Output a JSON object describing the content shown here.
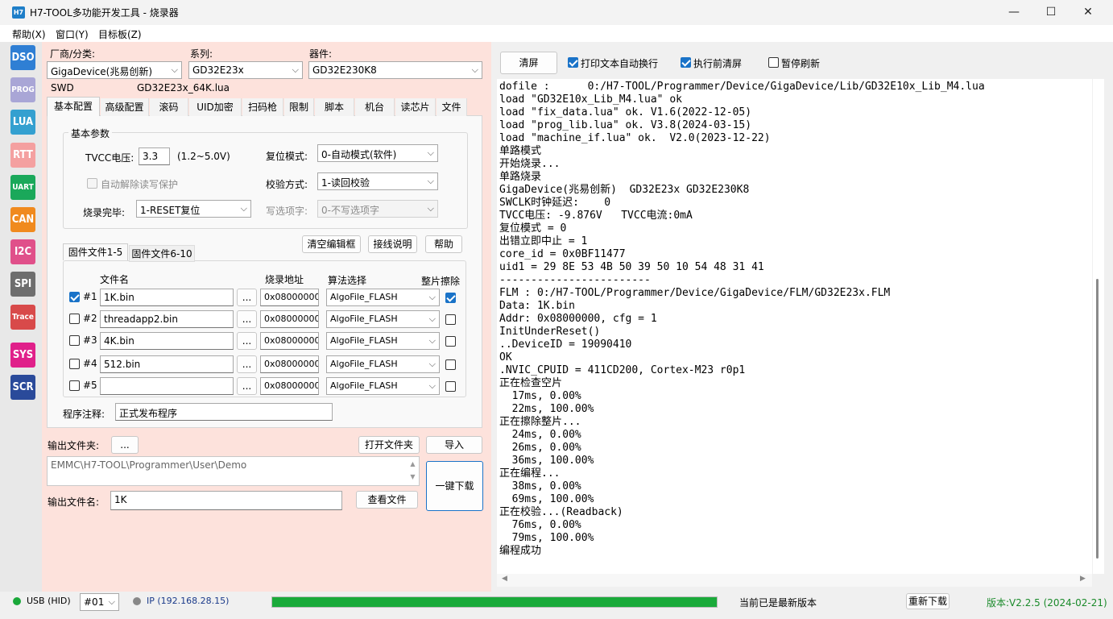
{
  "window": {
    "title": "H7-TOOL多功能开发工具 - 烧录器",
    "icon_text": "H7",
    "minimize": "—",
    "maximize": "☐",
    "close": "✕"
  },
  "menu": [
    "帮助(X)",
    "窗口(Y)",
    "目标板(Z)"
  ],
  "sidebar": [
    {
      "label": "DSO",
      "color": "#2f7fd4"
    },
    {
      "label": "PROG",
      "color": "#a9a6d6"
    },
    {
      "label": "LUA",
      "color": "#34a0d0"
    },
    {
      "label": "RTT",
      "color": "#f4a0a0"
    },
    {
      "label": "UART",
      "color": "#1aa85a"
    },
    {
      "label": "CAN",
      "color": "#f08a1e"
    },
    {
      "label": "I2C",
      "color": "#e0508a"
    },
    {
      "label": "SPI",
      "color": "#6e6e6e"
    },
    {
      "label": "Trace",
      "color": "#d84a4a"
    },
    {
      "label": "SYS",
      "color": "#e0208a"
    },
    {
      "label": "SCR",
      "color": "#2a4a9a"
    }
  ],
  "device": {
    "vendor_label": "厂商/分类:",
    "vendor_value": "GigaDevice(兆易创新)",
    "series_label": "系列:",
    "series_value": "GD32E23x",
    "chip_label": "器件:",
    "chip_value": "GD32E230K8",
    "interface": "SWD",
    "lua_file": "GD32E23x_64K.lua"
  },
  "tabs": [
    "基本配置",
    "高级配置",
    "滚码",
    "UID加密",
    "扫码枪",
    "限制",
    "脚本",
    "机台",
    "读芯片",
    "文件"
  ],
  "basic": {
    "group_title": "基本参数",
    "tvcc_label": "TVCC电压:",
    "tvcc_value": "3.3",
    "tvcc_range": "(1.2~5.0V)",
    "auto_unlock_label": "自动解除读写保护",
    "after_prog_label": "烧录完毕:",
    "after_prog_value": "1-RESET复位",
    "reset_mode_label": "复位模式:",
    "reset_mode_value": "0-自动模式(软件)",
    "verify_label": "校验方式:",
    "verify_value": "1-读回校验",
    "option_label": "写选项字:",
    "option_value": "0-不写选项字"
  },
  "buttons": {
    "clear_prog": "清空编辑框",
    "wiring": "接线说明",
    "help": "帮助"
  },
  "filetabs": [
    "固件文件1-5",
    "固件文件6-10"
  ],
  "file_headers": {
    "name": "文件名",
    "addr": "烧录地址",
    "algo": "算法选择",
    "erase": "整片擦除"
  },
  "files": [
    {
      "num": "#1",
      "checked": true,
      "name": "1K.bin",
      "browse": "...",
      "addr": "0x08000000",
      "algo": "AlgoFile_FLASH",
      "erase": true
    },
    {
      "num": "#2",
      "checked": false,
      "name": "threadapp2.bin",
      "browse": "...",
      "addr": "0x08000000",
      "algo": "AlgoFile_FLASH",
      "erase": false
    },
    {
      "num": "#3",
      "checked": false,
      "name": "4K.bin",
      "browse": "...",
      "addr": "0x08000000",
      "algo": "AlgoFile_FLASH",
      "erase": false
    },
    {
      "num": "#4",
      "checked": false,
      "name": "512.bin",
      "browse": "...",
      "addr": "0x08000000",
      "algo": "AlgoFile_FLASH",
      "erase": false
    },
    {
      "num": "#5",
      "checked": false,
      "name": "",
      "browse": "...",
      "addr": "0x08000000",
      "algo": "AlgoFile_FLASH",
      "erase": false
    }
  ],
  "comment": {
    "label": "程序注释:",
    "value": "正式发布程序"
  },
  "output": {
    "folder_label": "输出文件夹:",
    "folder_btn": "...",
    "open_folder": "打开文件夹",
    "import": "导入",
    "path": "EMMC\\H7-TOOL\\Programmer\\User\\Demo",
    "one_click": "一键下载",
    "filename_label": "输出文件名:",
    "filename_value": "1K",
    "view_file": "查看文件"
  },
  "right_toolbar": {
    "clear": "清屏",
    "wrap_label": "打印文本自动换行",
    "wrap_checked": true,
    "clear_before_label": "执行前清屏",
    "clear_before_checked": true,
    "pause_label": "暂停刷新",
    "pause_checked": false
  },
  "log": [
    "dofile :      0:/H7-TOOL/Programmer/Device/GigaDevice/Lib/GD32E10x_Lib_M4.lua",
    "load \"GD32E10x_Lib_M4.lua\" ok",
    "load \"fix_data.lua\" ok. V1.6(2022-12-05)",
    "load \"prog_lib.lua\" ok. V3.8(2024-03-15)",
    "load \"machine_if.lua\" ok.  V2.0(2023-12-22)",
    "单路模式",
    "开始烧录...",
    "单路烧录",
    "GigaDevice(兆易创新)  GD32E23x GD32E230K8",
    "SWCLK时钟延迟:    0",
    "TVCC电压: -9.876V   TVCC电流:0mA",
    "复位模式 = 0",
    "出错立即中止 = 1",
    "core_id = 0x0BF11477",
    "uid1 = 29 8E 53 4B 50 39 50 10 54 48 31 41",
    "------------------------",
    "FLM : 0:/H7-TOOL/Programmer/Device/GigaDevice/FLM/GD32E23x.FLM",
    "Data: 1K.bin",
    "Addr: 0x08000000, cfg = 1",
    "InitUnderReset()",
    "..DeviceID = 19090410",
    "OK",
    ".NVIC_CPUID = 411CD200, Cortex-M23 r0p1",
    "正在检查空片",
    "  17ms, 0.00%",
    "  22ms, 100.00%",
    "正在擦除整片...",
    "  24ms, 0.00%",
    "  26ms, 0.00%",
    "  36ms, 100.00%",
    "正在编程...",
    "  38ms, 0.00%",
    "  69ms, 100.00%",
    "正在校验...(Readback)",
    "  76ms, 0.00%",
    "  79ms, 100.00%",
    "编程成功"
  ],
  "status": {
    "usb": "USB (HID)",
    "channel": "#01",
    "ip": "IP (192.168.28.15)",
    "progress": 1.0,
    "progress_color": "#1aaa3a",
    "update_msg": "当前已是最新版本",
    "redownload": "重新下载",
    "version": "版本:V2.2.5 (2024-02-21)"
  }
}
